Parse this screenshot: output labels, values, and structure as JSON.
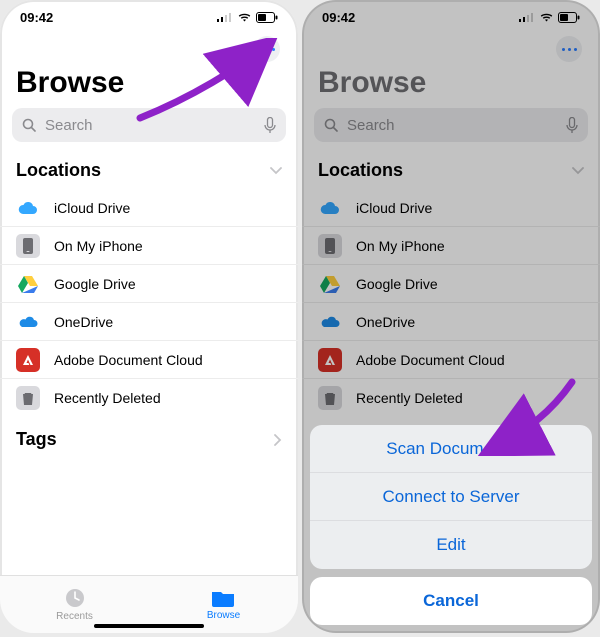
{
  "status": {
    "time": "09:42"
  },
  "header": {
    "title": "Browse"
  },
  "search": {
    "placeholder": "Search"
  },
  "sections": {
    "locations_label": "Locations",
    "tags_label": "Tags"
  },
  "locations": [
    {
      "label": "iCloud Drive",
      "icon": "cloud",
      "fg": "#fff",
      "bg": "#3fa9ff"
    },
    {
      "label": "On My iPhone",
      "icon": "phone",
      "fg": "#6c6c71",
      "bg": "#d9d9dd"
    },
    {
      "label": "Google Drive",
      "icon": "gdrive",
      "fg": "",
      "bg": "transparent"
    },
    {
      "label": "OneDrive",
      "icon": "onedrive",
      "fg": "#fff",
      "bg": "#1e8be6"
    },
    {
      "label": "Adobe Document Cloud",
      "icon": "adobe",
      "fg": "#fff",
      "bg": "#d63027"
    },
    {
      "label": "Recently Deleted",
      "icon": "trash",
      "fg": "#6c6c71",
      "bg": "#d9d9dd"
    }
  ],
  "tabs": {
    "recents": "Recents",
    "browse": "Browse"
  },
  "action_sheet": {
    "items": [
      "Scan Documents",
      "Connect to Server",
      "Edit"
    ],
    "cancel": "Cancel"
  }
}
